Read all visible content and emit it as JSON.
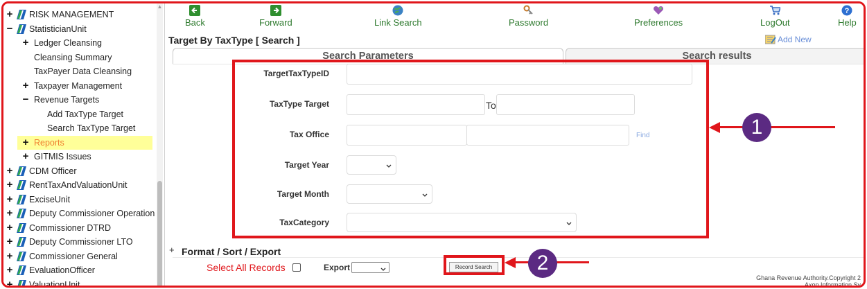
{
  "sidebar": {
    "items": [
      {
        "label": "RISK MANAGEMENT",
        "marker": "+",
        "flag": true,
        "indent": 0
      },
      {
        "label": "StatisticianUnit",
        "marker": "−",
        "flag": true,
        "indent": 0
      },
      {
        "label": "Ledger Cleansing",
        "marker": "+",
        "flag": false,
        "indent": 1
      },
      {
        "label": "Cleansing Summary",
        "marker": "",
        "flag": false,
        "indent": 1
      },
      {
        "label": "TaxPayer Data Cleansing",
        "marker": "",
        "flag": false,
        "indent": 1
      },
      {
        "label": "Taxpayer Management",
        "marker": "+",
        "flag": false,
        "indent": 1
      },
      {
        "label": "Revenue Targets",
        "marker": "−",
        "flag": false,
        "indent": 1
      },
      {
        "label": "Add TaxType Target",
        "marker": "",
        "flag": false,
        "indent": 2
      },
      {
        "label": "Search TaxType Target",
        "marker": "",
        "flag": false,
        "indent": 2
      },
      {
        "label": "Reports",
        "marker": "+",
        "flag": false,
        "indent": 1,
        "highlight": true
      },
      {
        "label": "GITMIS Issues",
        "marker": "+",
        "flag": false,
        "indent": 1
      },
      {
        "label": "CDM Officer",
        "marker": "+",
        "flag": true,
        "indent": 0
      },
      {
        "label": "RentTaxAndValuationUnit",
        "marker": "+",
        "flag": true,
        "indent": 0
      },
      {
        "label": "ExciseUnit",
        "marker": "+",
        "flag": true,
        "indent": 0
      },
      {
        "label": "Deputy Commissioner Operation",
        "marker": "+",
        "flag": true,
        "indent": 0
      },
      {
        "label": "Commissioner DTRD",
        "marker": "+",
        "flag": true,
        "indent": 0
      },
      {
        "label": "Deputy Commissioner LTO",
        "marker": "+",
        "flag": true,
        "indent": 0
      },
      {
        "label": "Commissioner General",
        "marker": "+",
        "flag": true,
        "indent": 0
      },
      {
        "label": "EvaluationOfficer",
        "marker": "+",
        "flag": true,
        "indent": 0
      },
      {
        "label": "ValuationUnit",
        "marker": "+",
        "flag": true,
        "indent": 0
      }
    ]
  },
  "toolbar": {
    "back": {
      "label": "Back",
      "icon": "back-arrow-icon"
    },
    "forward": {
      "label": "Forward",
      "icon": "forward-arrow-icon"
    },
    "link_search": {
      "label": "Link Search",
      "icon": "globe-icon"
    },
    "password": {
      "label": "Password",
      "icon": "key-icon"
    },
    "preferences": {
      "label": "Preferences",
      "icon": "heart-icon"
    },
    "logout": {
      "label": "LogOut",
      "icon": "cart-icon"
    },
    "help": {
      "label": "Help",
      "icon": "help-icon"
    }
  },
  "page": {
    "title": "Target By TaxType [ Search ]",
    "add_new": "Add New"
  },
  "tabs": {
    "search_parameters": "Search Parameters",
    "search_results": "Search results"
  },
  "form": {
    "target_tax_type_id": {
      "label": "TargetTaxTypeID",
      "value": ""
    },
    "tax_type_target": {
      "label": "TaxType Target",
      "from": "",
      "to_label": "To",
      "to": ""
    },
    "tax_office": {
      "label": "Tax Office",
      "code": "",
      "name": "",
      "find": "Find"
    },
    "target_year": {
      "label": "Target Year",
      "value": ""
    },
    "target_month": {
      "label": "Target Month",
      "value": ""
    },
    "tax_category": {
      "label": "TaxCategory",
      "value": ""
    }
  },
  "format_section": {
    "plus": "+",
    "title": "Format / Sort / Export",
    "select_all": "Select All Records",
    "export_label": "Export",
    "export_value": "",
    "record_search": "Record Search"
  },
  "annotations": {
    "callout_1": "1",
    "callout_2": "2",
    "color": "#e0161b",
    "callout_color": "#5b2a82"
  },
  "footer": {
    "line1": "Ghana Revenue Authority.Copyright 2",
    "line2": "Axon Information Sy"
  }
}
